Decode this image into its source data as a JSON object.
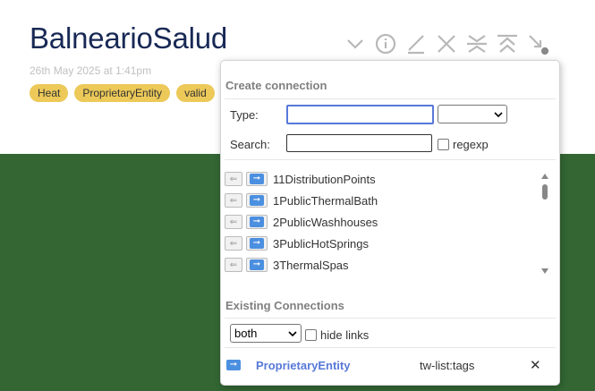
{
  "tiddler": {
    "title": "BalnearioSalud",
    "subtitle": "26th May 2025 at 1:41pm",
    "tags": [
      "Heat",
      "ProprietaryEntity",
      "valid"
    ]
  },
  "toolbar": {
    "icons": [
      "chevron-down-icon",
      "info-icon",
      "edit-icon",
      "close-icon",
      "close-others-icon",
      "fold-icon",
      "link-icon"
    ]
  },
  "popup": {
    "create_heading": "Create connection",
    "type_label": "Type:",
    "type_value": "",
    "type_select_value": "",
    "search_label": "Search:",
    "search_value": "",
    "regexp_label": "regexp",
    "items": [
      "11DistributionPoints",
      "1PublicThermalBath",
      "2PublicWashhouses",
      "3PublicHotSprings",
      "3ThermalSpas"
    ],
    "existing_heading": "Existing Connections",
    "mode_select": "both",
    "hide_links_label": "hide links",
    "connections": [
      {
        "name": "ProprietaryEntity",
        "field": "tw-list:tags"
      }
    ]
  },
  "colors": {
    "green_band": "#336633",
    "title": "#182955",
    "tag_bg": "#ecc958",
    "accent": "#5778d8",
    "arrow_btn": "#4b8fe0"
  }
}
